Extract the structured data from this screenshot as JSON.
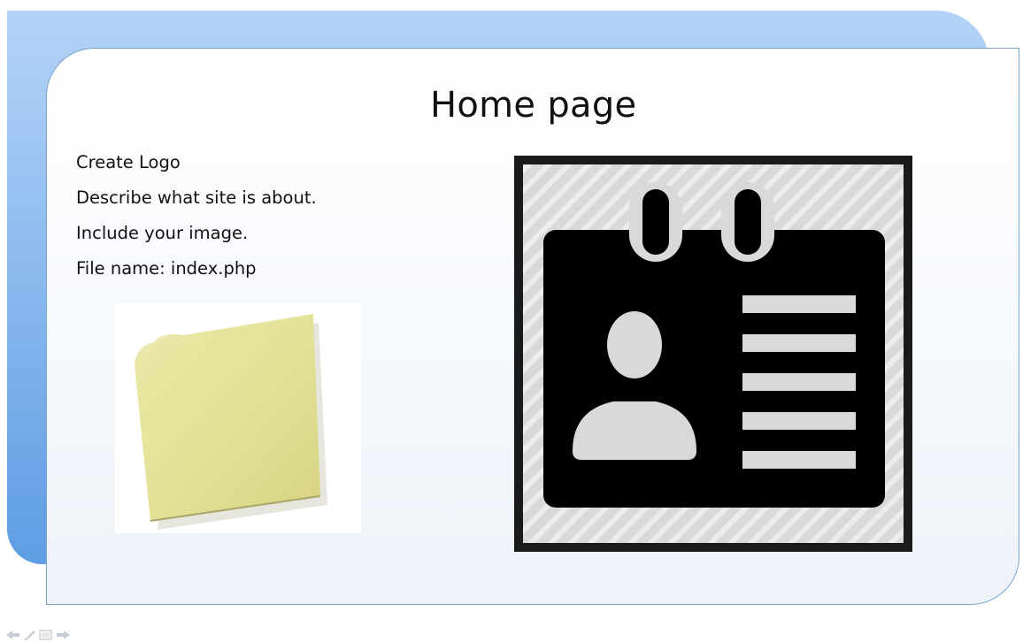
{
  "slide": {
    "title": "Home page",
    "bullets": [
      "Create Logo",
      "Describe what site is about.",
      "Include your image.",
      "File name: index.php"
    ]
  },
  "images": {
    "sticky_note": "sticky-note-photo",
    "badge_icon": "id-badge-icon"
  },
  "nav": {
    "items": [
      "previous-slide-icon",
      "pen-icon",
      "slide-menu-icon",
      "next-slide-icon"
    ]
  },
  "colors": {
    "backdrop_top": "#b4d3f7",
    "backdrop_bottom": "#5f9de3",
    "card_border": "#7aa3cc",
    "sticky_note": "#e4e29b"
  }
}
